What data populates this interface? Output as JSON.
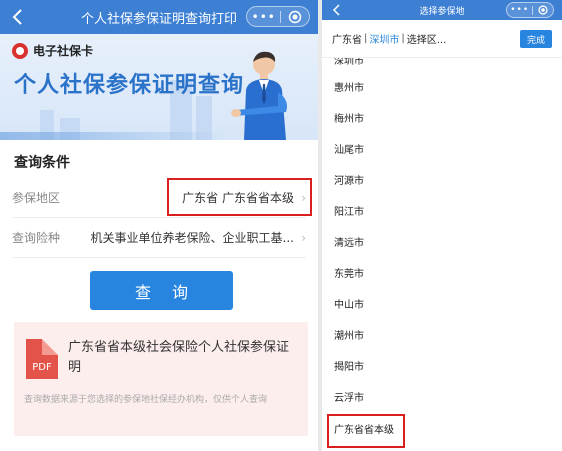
{
  "left": {
    "nav": {
      "title": "个人社保参保证明查询打印",
      "capsule_dots": "•••"
    },
    "banner": {
      "logo_text": "电子社保卡",
      "title": "个人社保参保证明查询"
    },
    "section_title": "查询条件",
    "form": {
      "region_label": "参保地区",
      "region_value": "广东省 广东省省本级",
      "insurance_label": "查询险种",
      "insurance_value": "机关事业单位养老保险、企业职工基..."
    },
    "query_button": "查 询",
    "result_card": {
      "icon_label": "PDF",
      "title": "广东省省本级社会保险个人社保参保证明",
      "note": "查询数据来源于您选择的参保地社保经办机构，仅供个人查询"
    }
  },
  "right": {
    "nav": {
      "title": "选择参保地",
      "capsule_dots": "•••"
    },
    "picker": {
      "province": "广东省",
      "divider": "|",
      "city": "深圳市",
      "district": "选择区...",
      "done_label": "完成"
    },
    "cities": [
      "惠州市",
      "梅州市",
      "汕尾市",
      "河源市",
      "阳江市",
      "清远市",
      "东莞市",
      "中山市",
      "潮州市",
      "揭阳市",
      "云浮市",
      "广东省省本级"
    ],
    "partial_city": "深圳市"
  },
  "colors": {
    "nav_blue": "#3c7fd3",
    "button_blue": "#2784df",
    "highlight_red": "#d9201e",
    "active_blue": "#2b86d9"
  },
  "icons": [
    "back-arrow-icon",
    "more-dots-icon",
    "target-icon",
    "chevron-right-icon",
    "pdf-icon"
  ]
}
